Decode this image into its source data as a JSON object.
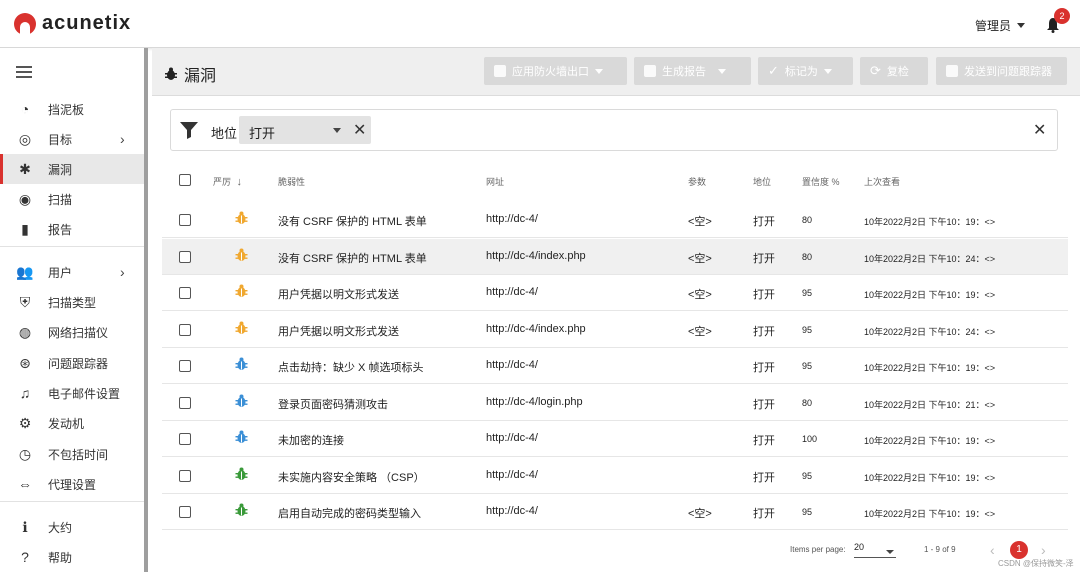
{
  "app": {
    "brand": "acunetix"
  },
  "header": {
    "user": "管理员",
    "notifications": "2"
  },
  "sidebar": {
    "items": [
      {
        "label": "挡泥板",
        "icon": "dashboard-icon"
      },
      {
        "label": "目标",
        "icon": "target-icon",
        "chevron": true
      },
      {
        "label": "漏洞",
        "icon": "bug-icon",
        "active": true
      },
      {
        "label": "扫描",
        "icon": "scan-icon"
      },
      {
        "label": "报告",
        "icon": "report-icon"
      },
      {
        "label": "用户",
        "icon": "users-icon",
        "chevron": true
      },
      {
        "label": "扫描类型",
        "icon": "shield-icon"
      },
      {
        "label": "网络扫描仪",
        "icon": "network-scanner-icon"
      },
      {
        "label": "问题跟踪器",
        "icon": "issue-tracker-icon"
      },
      {
        "label": "电子邮件设置",
        "icon": "bell-icon"
      },
      {
        "label": "发动机",
        "icon": "engine-icon"
      },
      {
        "label": "不包括时间",
        "icon": "clock-icon"
      },
      {
        "label": "代理设置",
        "icon": "proxy-icon"
      },
      {
        "label": "大约",
        "icon": "info-icon"
      },
      {
        "label": "帮助",
        "icon": "help-icon"
      }
    ]
  },
  "page": {
    "title": "漏洞",
    "toolbar": {
      "waf_export": "应用防火墙出口",
      "generate_report": "生成报告",
      "mark_as": "标记为",
      "retest": "复检",
      "send_to_tracker": "发送到问题跟踪器"
    },
    "filter": {
      "label": "地位",
      "value": "打开"
    }
  },
  "table": {
    "headers": {
      "severity": "严厉",
      "vulnerability": "脆弱性",
      "url": "网址",
      "parameter": "参数",
      "status": "地位",
      "confidence": "置信度 %",
      "last_seen": "上次查看"
    },
    "rows": [
      {
        "severity": "medium",
        "name": "没有 CSRF 保护的 HTML 表单",
        "url": "http://dc-4/",
        "param": "<空>",
        "status": "打开",
        "confidence": "80",
        "last_seen": "10年2022月2日 下午10：19：<>"
      },
      {
        "severity": "medium",
        "name": "没有 CSRF 保护的 HTML 表单",
        "url": "http://dc-4/index.php",
        "param": "<空>",
        "status": "打开",
        "confidence": "80",
        "last_seen": "10年2022月2日 下午10：24：<>"
      },
      {
        "severity": "medium",
        "name": "用户凭据以明文形式发送",
        "url": "http://dc-4/",
        "param": "<空>",
        "status": "打开",
        "confidence": "95",
        "last_seen": "10年2022月2日 下午10：19：<>"
      },
      {
        "severity": "medium",
        "name": "用户凭据以明文形式发送",
        "url": "http://dc-4/index.php",
        "param": "<空>",
        "status": "打开",
        "confidence": "95",
        "last_seen": "10年2022月2日 下午10：24：<>"
      },
      {
        "severity": "low",
        "name": "点击劫持：缺少 X 帧选项标头",
        "url": "http://dc-4/",
        "param": "",
        "status": "打开",
        "confidence": "95",
        "last_seen": "10年2022月2日 下午10：19：<>"
      },
      {
        "severity": "low",
        "name": "登录页面密码猜测攻击",
        "url": "http://dc-4/login.php",
        "param": "",
        "status": "打开",
        "confidence": "80",
        "last_seen": "10年2022月2日 下午10：21：<>"
      },
      {
        "severity": "low",
        "name": "未加密的连接",
        "url": "http://dc-4/",
        "param": "",
        "status": "打开",
        "confidence": "100",
        "last_seen": "10年2022月2日 下午10：19：<>"
      },
      {
        "severity": "info",
        "name": "未实施内容安全策略 （CSP）",
        "url": "http://dc-4/",
        "param": "",
        "status": "打开",
        "confidence": "95",
        "last_seen": "10年2022月2日 下午10：19：<>"
      },
      {
        "severity": "info",
        "name": "启用自动完成的密码类型输入",
        "url": "http://dc-4/",
        "param": "<空>",
        "status": "打开",
        "confidence": "95",
        "last_seen": "10年2022月2日 下午10：19：<>"
      }
    ]
  },
  "pagination": {
    "items_per_page_label": "Items per page:",
    "items_per_page": "20",
    "range": "1 - 9 of 9",
    "current_page": "1"
  },
  "colors": {
    "accent": "#d9322e",
    "medium": "#f0a830",
    "low": "#3b8fd6",
    "info": "#3a9a3a"
  },
  "watermark": "CSDN @保持微笑-泽"
}
